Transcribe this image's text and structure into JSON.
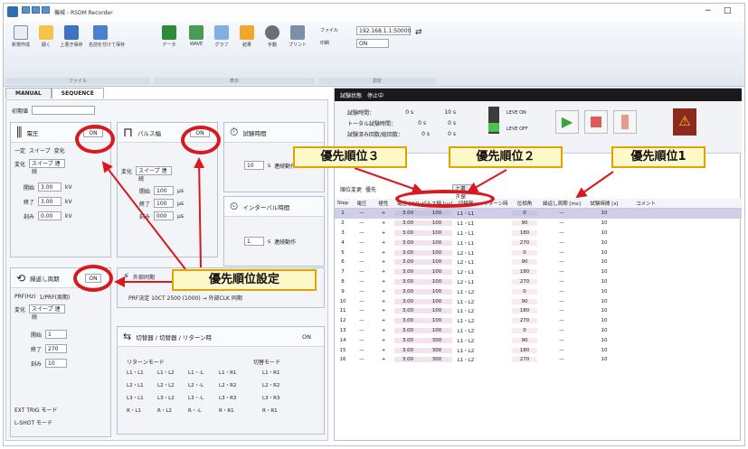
{
  "window": {
    "title": "機械 - RSDM Recorder",
    "min": "−",
    "max": "□",
    "quick_access": [
      "保存",
      "上書",
      "戻す"
    ]
  },
  "ribbon": {
    "buttons": [
      "新規作成",
      "開く",
      "上書き保存",
      "名前を付けて保存",
      "データ",
      "WAVE",
      "グラフ",
      "結果",
      "手動",
      "プリント",
      "ファイル",
      "印刷"
    ],
    "right_labels": [
      "電源ON",
      "電源OFF"
    ],
    "groups": [
      "ファイル",
      "表示",
      "測定"
    ],
    "icons": [
      "new-icon",
      "open-icon",
      "save-icon",
      "saveas-icon",
      "excel-icon",
      "graph-icon",
      "chart-icon",
      "warning-icon",
      "gear-icon",
      "print-icon"
    ],
    "select_value": "192.168.1.1:50000",
    "right_value": "ON"
  },
  "left_tabs": [
    "MANUAL",
    "SEQUENCE"
  ],
  "left": {
    "header_label": "初期値",
    "power": {
      "title": "電圧",
      "badge": "ON",
      "radios": [
        "一定",
        "スイープ",
        "変化"
      ],
      "mode_label": "変化",
      "mode_value": "スイープ 連続",
      "rows": [
        [
          "開始",
          "3.00",
          "kV"
        ],
        [
          "終了",
          "3.00",
          "kV"
        ],
        [
          "刻み",
          "0.00",
          "kV"
        ]
      ]
    },
    "pulse": {
      "title": "パルス幅",
      "badge": "ON",
      "mode_label": "変化",
      "mode_value": "スイープ 連続",
      "rows": [
        [
          "開始",
          "100",
          "μs"
        ],
        [
          "終了",
          "100",
          "μs"
        ],
        [
          "刻み",
          "000",
          "μs"
        ]
      ]
    },
    "timer": {
      "title": "試験時間",
      "value": "10",
      "unit": "s",
      "check": "連続動作"
    },
    "interval": {
      "title": "インターバル時間",
      "value": "1",
      "unit": "s",
      "check": "連続動作"
    },
    "repeat": {
      "title": "繰返し周期",
      "badge": "ON",
      "radios": [
        "PRF(Hz)",
        "1/PRF(周期)"
      ],
      "mode_label": "変化",
      "mode_value": "スイープ 連続",
      "rows": [
        [
          "開始",
          "1"
        ],
        [
          "終了",
          "270"
        ],
        [
          "刻み",
          "10"
        ]
      ]
    },
    "sync": {
      "title": "外部同期",
      "text": "PRF決定 10CT  2500 (1000) → 外部CLK 同期"
    },
    "polarity": {
      "title": "切替器 / 切替器 / リターン時",
      "badge": "ON",
      "left_head": "リターンモード",
      "right_head": "切替モード",
      "checks": [
        "L1・L1",
        "L1・L2",
        "L1・-L",
        "L1・R1",
        "L2・L1",
        "L2・L2",
        "L2・-L",
        "L2・R2",
        "L3・L1",
        "L3・L2",
        "L3・-L",
        "L3・R3",
        "R・L1",
        "R・L2",
        "R・-L",
        "R・R1"
      ],
      "right_checks": [
        "L1・R1",
        "L2・R2",
        "L3・R3",
        "R・R1"
      ]
    },
    "bottom_checks": [
      "EXT TRIG モード",
      "L-SHOT モード"
    ]
  },
  "right": {
    "header_tabs": [
      "試験状態",
      "停止中"
    ],
    "status_rows": [
      [
        "試験時間：",
        "0 s",
        "10 s"
      ],
      [
        "トータル試験時間：",
        "0 s",
        "0 s"
      ],
      [
        "試験済み回数/総回数：",
        "0 s",
        "0 s"
      ]
    ],
    "power_on": "LEVE ON",
    "power_off": "LEVE OFF",
    "toolbar": [
      "順位変更",
      "優先",
      "上書き保存"
    ],
    "table_headers": [
      "Step",
      "電圧",
      "極性",
      "電圧 [kV]",
      "パルス幅 [μs]",
      "切替器",
      "リターン時",
      "位相角",
      "繰返し周期 [ms]",
      "試験時間 [s]",
      "コメント"
    ],
    "rows": [
      [
        "1",
        "—",
        "+",
        "3.00",
        "100",
        "L1・L1",
        "0",
        "—",
        "10"
      ],
      [
        "2",
        "—",
        "+",
        "3.00",
        "100",
        "L1・L1",
        "90",
        "—",
        "10"
      ],
      [
        "3",
        "—",
        "+",
        "3.00",
        "100",
        "L1・L1",
        "180",
        "—",
        "10"
      ],
      [
        "4",
        "—",
        "+",
        "3.00",
        "100",
        "L1・L1",
        "270",
        "—",
        "10"
      ],
      [
        "5",
        "—",
        "+",
        "3.00",
        "100",
        "L2・L1",
        "0",
        "—",
        "10"
      ],
      [
        "6",
        "—",
        "+",
        "3.00",
        "100",
        "L2・L1",
        "90",
        "—",
        "10"
      ],
      [
        "7",
        "—",
        "+",
        "3.00",
        "100",
        "L2・L1",
        "180",
        "—",
        "10"
      ],
      [
        "8",
        "—",
        "+",
        "3.00",
        "100",
        "L2・L1",
        "270",
        "—",
        "10"
      ],
      [
        "9",
        "—",
        "+",
        "3.00",
        "100",
        "L1・L2",
        "0",
        "—",
        "10"
      ],
      [
        "10",
        "—",
        "+",
        "3.00",
        "100",
        "L1・L2",
        "90",
        "—",
        "10"
      ],
      [
        "11",
        "—",
        "+",
        "3.00",
        "100",
        "L1・L2",
        "180",
        "—",
        "10"
      ],
      [
        "12",
        "—",
        "+",
        "3.00",
        "100",
        "L1・L2",
        "270",
        "—",
        "10"
      ],
      [
        "13",
        "—",
        "+",
        "3.00",
        "100",
        "L1・L2",
        "0",
        "—",
        "10"
      ],
      [
        "14",
        "—",
        "+",
        "3.00",
        "300",
        "L1・L2",
        "90",
        "—",
        "10"
      ],
      [
        "15",
        "—",
        "+",
        "3.00",
        "300",
        "L1・L2",
        "180",
        "—",
        "10"
      ],
      [
        "16",
        "—",
        "+",
        "3.00",
        "300",
        "L1・L2",
        "270",
        "—",
        "10"
      ]
    ]
  },
  "annotations": {
    "p3": "優先順位３",
    "p2": "優先順位２",
    "p1": "優先順位1",
    "setting": "優先順位設定"
  },
  "colors": {
    "accent_red": "#d71920",
    "label_bg": "#fff8c8",
    "label_border": "#e0a300",
    "selected_row": "#cfcdea",
    "col_highlight": "#f3e3ee"
  }
}
